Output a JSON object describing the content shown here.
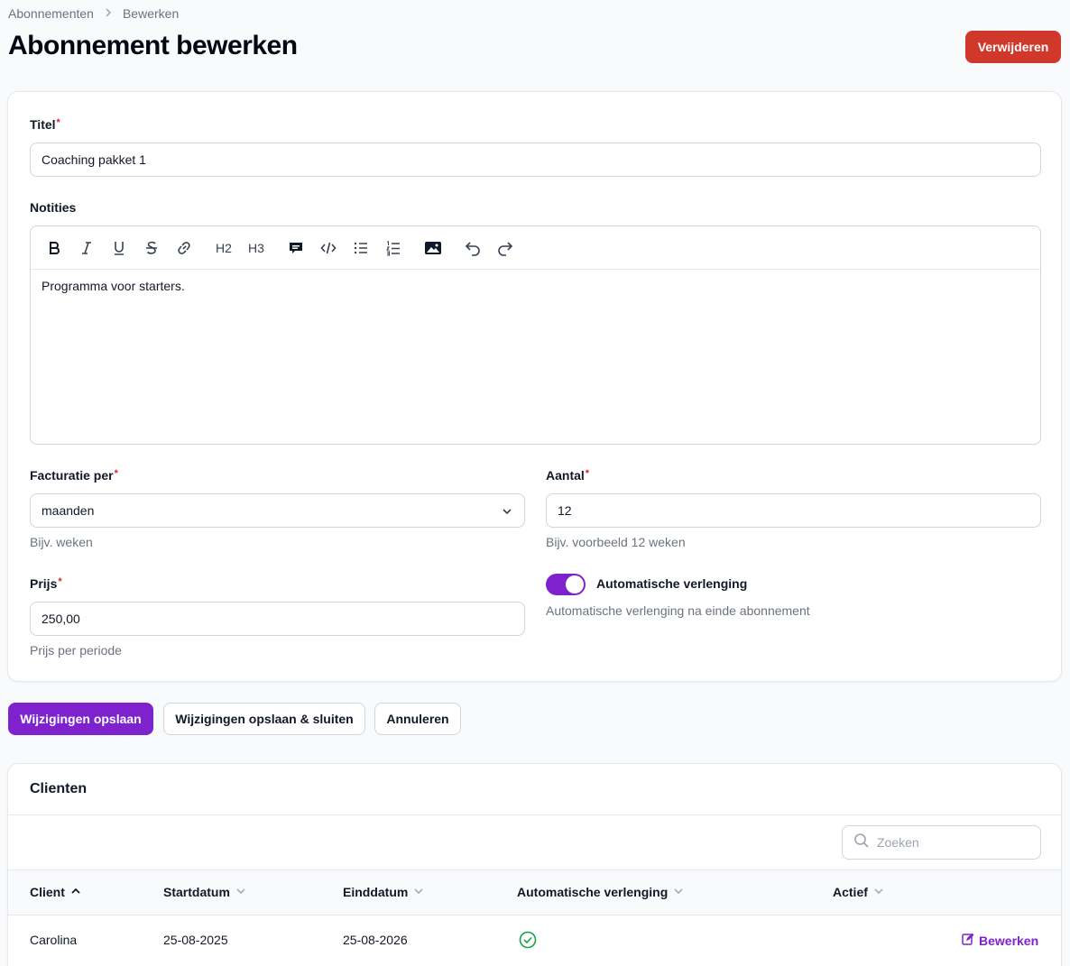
{
  "breadcrumb": {
    "items": [
      "Abonnementen",
      "Bewerken"
    ]
  },
  "page": {
    "title": "Abonnement bewerken",
    "delete_label": "Verwijderen"
  },
  "form": {
    "title_label": "Titel",
    "title_value": "Coaching pakket 1",
    "notes_label": "Notities",
    "notes_content": "Programma voor starters.",
    "billing_label": "Facturatie per",
    "billing_value": "maanden",
    "billing_hint": "Bijv. weken",
    "amount_label": "Aantal",
    "amount_value": "12",
    "amount_hint": "Bijv. voorbeeld 12 weken",
    "price_label": "Prijs",
    "price_value": "250,00",
    "price_hint": "Prijs per periode",
    "auto_renew_label": "Automatische verlenging",
    "auto_renew_hint": "Automatische verlenging na einde abonnement",
    "auto_renew_on": true
  },
  "toolbar": {
    "icons": [
      "bold-icon",
      "italic-icon",
      "underline-icon",
      "strikethrough-icon",
      "link-icon",
      "heading-2-icon",
      "heading-3-icon",
      "blockquote-icon",
      "code-block-icon",
      "bullet-list-icon",
      "ordered-list-icon",
      "image-icon",
      "undo-icon",
      "redo-icon"
    ],
    "h2": "H2",
    "h3": "H3"
  },
  "actions": {
    "save_label": "Wijzigingen opslaan",
    "save_close_label": "Wijzigingen opslaan & sluiten",
    "cancel_label": "Annuleren"
  },
  "clients_table": {
    "title": "Clienten",
    "search_placeholder": "Zoeken",
    "columns": [
      "Client",
      "Startdatum",
      "Einddatum",
      "Automatische verlenging",
      "Actief"
    ],
    "rows": [
      {
        "client": "Carolina",
        "start": "25-08-2025",
        "end": "25-08-2026",
        "auto_renew": true,
        "edit_label": "Bewerken"
      }
    ]
  },
  "colors": {
    "primary": "#7e22ce",
    "danger": "#d0382b",
    "success": "#16a34a"
  }
}
